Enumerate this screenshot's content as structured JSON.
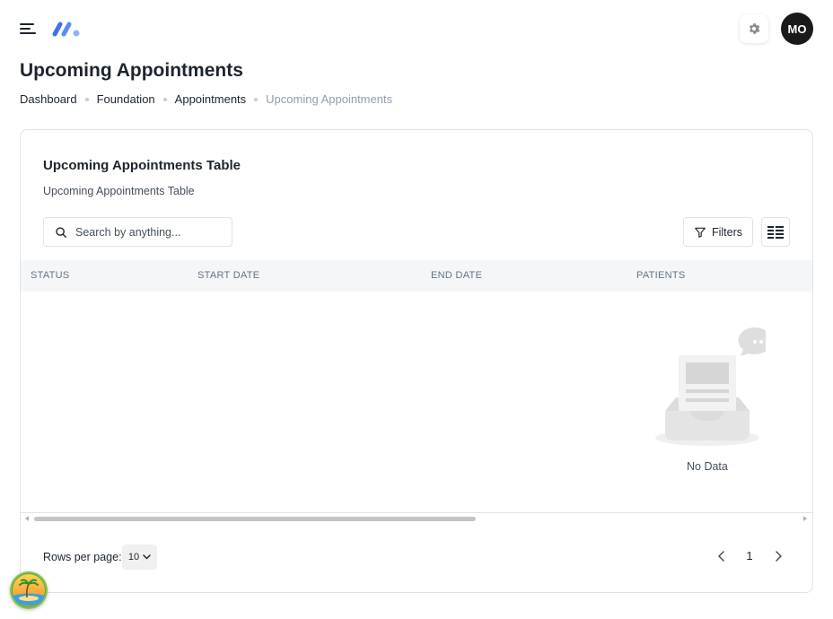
{
  "header": {
    "menu_icon": "hamburger-icon",
    "logo_icon": "brand-logo",
    "settings_icon": "gear-icon",
    "avatar_initials": "MO",
    "accent_color": "#5b8def"
  },
  "page": {
    "title": "Upcoming Appointments",
    "breadcrumb": [
      {
        "label": "Dashboard"
      },
      {
        "label": "Foundation"
      },
      {
        "label": "Appointments"
      },
      {
        "label": "Upcoming Appointments"
      }
    ]
  },
  "card": {
    "title": "Upcoming Appointments Table",
    "subtitle": "Upcoming Appointments Table",
    "search_placeholder": "Search by anything...",
    "filters_label": "Filters",
    "columns_icon": "columns-icon"
  },
  "table": {
    "columns": [
      "STATUS",
      "START DATE",
      "END DATE",
      "PATIENTS"
    ],
    "rows": [],
    "empty_text": "No Data"
  },
  "pagination": {
    "rows_per_page_label": "Rows per page:",
    "rows_per_page_value": "10",
    "current_page": "1"
  }
}
